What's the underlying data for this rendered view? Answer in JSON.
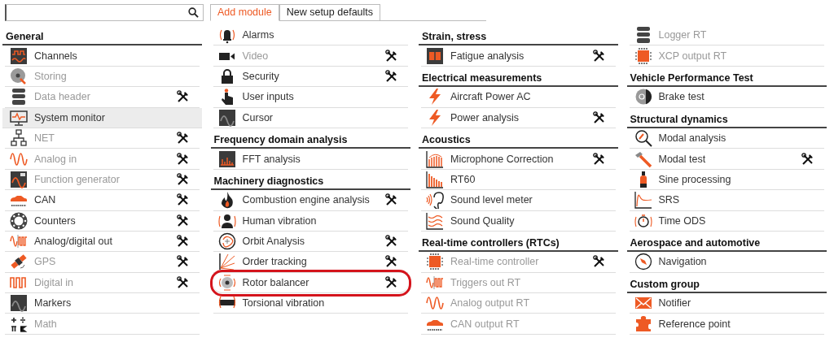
{
  "tabs": [
    {
      "label": "Add module",
      "selected": true
    },
    {
      "label": "New setup defaults",
      "selected": false
    }
  ],
  "columns": [
    {
      "entries": [
        {
          "kind": "heading",
          "label": "General"
        },
        {
          "kind": "item",
          "label": "Channels",
          "disabled": false,
          "settings": false,
          "selected": false,
          "circled": false
        },
        {
          "kind": "item",
          "label": "Storing",
          "disabled": true,
          "settings": false,
          "selected": false,
          "circled": false
        },
        {
          "kind": "item",
          "label": "Data header",
          "disabled": true,
          "settings": true,
          "selected": false,
          "circled": false
        },
        {
          "kind": "item",
          "label": "System monitor",
          "disabled": false,
          "settings": false,
          "selected": true,
          "circled": false
        },
        {
          "kind": "item",
          "label": "NET",
          "disabled": true,
          "settings": true,
          "selected": false,
          "circled": false
        },
        {
          "kind": "item",
          "label": "Analog in",
          "disabled": true,
          "settings": true,
          "selected": false,
          "circled": false
        },
        {
          "kind": "item",
          "label": "Function generator",
          "disabled": true,
          "settings": true,
          "selected": false,
          "circled": false
        },
        {
          "kind": "item",
          "label": "CAN",
          "disabled": false,
          "settings": true,
          "selected": false,
          "circled": false
        },
        {
          "kind": "item",
          "label": "Counters",
          "disabled": false,
          "settings": true,
          "selected": false,
          "circled": false
        },
        {
          "kind": "item",
          "label": "Analog/digital out",
          "disabled": false,
          "settings": true,
          "selected": false,
          "circled": false
        },
        {
          "kind": "item",
          "label": "GPS",
          "disabled": true,
          "settings": true,
          "selected": false,
          "circled": false
        },
        {
          "kind": "item",
          "label": "Digital in",
          "disabled": true,
          "settings": true,
          "selected": false,
          "circled": false
        },
        {
          "kind": "item",
          "label": "Markers",
          "disabled": false,
          "settings": false,
          "selected": false,
          "circled": false
        },
        {
          "kind": "item",
          "label": "Math",
          "disabled": true,
          "settings": false,
          "selected": false,
          "circled": false
        }
      ]
    },
    {
      "entries": [
        {
          "kind": "item",
          "label": "Alarms",
          "disabled": false,
          "settings": false,
          "selected": false,
          "circled": false
        },
        {
          "kind": "item",
          "label": "Video",
          "disabled": true,
          "settings": true,
          "selected": false,
          "circled": false
        },
        {
          "kind": "item",
          "label": "Security",
          "disabled": false,
          "settings": true,
          "selected": false,
          "circled": false
        },
        {
          "kind": "item",
          "label": "User inputs",
          "disabled": false,
          "settings": false,
          "selected": false,
          "circled": false
        },
        {
          "kind": "item",
          "label": "Cursor",
          "disabled": false,
          "settings": false,
          "selected": false,
          "circled": false
        },
        {
          "kind": "heading",
          "label": "Frequency domain analysis"
        },
        {
          "kind": "item",
          "label": "FFT analysis",
          "disabled": false,
          "settings": false,
          "selected": false,
          "circled": false
        },
        {
          "kind": "heading",
          "label": "Machinery diagnostics"
        },
        {
          "kind": "item",
          "label": "Combustion engine analysis",
          "disabled": false,
          "settings": true,
          "selected": false,
          "circled": false
        },
        {
          "kind": "item",
          "label": "Human vibration",
          "disabled": false,
          "settings": false,
          "selected": false,
          "circled": false
        },
        {
          "kind": "item",
          "label": "Orbit Analysis",
          "disabled": false,
          "settings": true,
          "selected": false,
          "circled": false
        },
        {
          "kind": "item",
          "label": "Order tracking",
          "disabled": false,
          "settings": true,
          "selected": false,
          "circled": false
        },
        {
          "kind": "item",
          "label": "Rotor balancer",
          "disabled": false,
          "settings": true,
          "selected": false,
          "circled": true
        },
        {
          "kind": "item",
          "label": "Torsional vibration",
          "disabled": false,
          "settings": false,
          "selected": false,
          "circled": false
        }
      ]
    },
    {
      "entries": [
        {
          "kind": "heading",
          "label": "Strain, stress"
        },
        {
          "kind": "item",
          "label": "Fatigue analysis",
          "disabled": false,
          "settings": true,
          "selected": false,
          "circled": false
        },
        {
          "kind": "heading",
          "label": "Electrical measurements"
        },
        {
          "kind": "item",
          "label": "Aircraft Power AC",
          "disabled": false,
          "settings": false,
          "selected": false,
          "circled": false
        },
        {
          "kind": "item",
          "label": "Power analysis",
          "disabled": false,
          "settings": true,
          "selected": false,
          "circled": false
        },
        {
          "kind": "heading",
          "label": "Acoustics"
        },
        {
          "kind": "item",
          "label": "Microphone Correction",
          "disabled": false,
          "settings": true,
          "selected": false,
          "circled": false
        },
        {
          "kind": "item",
          "label": "RT60",
          "disabled": false,
          "settings": false,
          "selected": false,
          "circled": false
        },
        {
          "kind": "item",
          "label": "Sound level meter",
          "disabled": false,
          "settings": false,
          "selected": false,
          "circled": false
        },
        {
          "kind": "item",
          "label": "Sound Quality",
          "disabled": false,
          "settings": false,
          "selected": false,
          "circled": false
        },
        {
          "kind": "heading",
          "label": "Real-time controllers (RTCs)"
        },
        {
          "kind": "item",
          "label": "Real-time controller",
          "disabled": true,
          "settings": true,
          "selected": false,
          "circled": false
        },
        {
          "kind": "item",
          "label": "Triggers out RT",
          "disabled": true,
          "settings": false,
          "selected": false,
          "circled": false
        },
        {
          "kind": "item",
          "label": "Analog output RT",
          "disabled": true,
          "settings": false,
          "selected": false,
          "circled": false
        },
        {
          "kind": "item",
          "label": "CAN output RT",
          "disabled": true,
          "settings": false,
          "selected": false,
          "circled": false
        }
      ]
    },
    {
      "entries": [
        {
          "kind": "item",
          "label": "Logger RT",
          "disabled": true,
          "settings": false,
          "selected": false,
          "circled": false
        },
        {
          "kind": "item",
          "label": "XCP output RT",
          "disabled": true,
          "settings": false,
          "selected": false,
          "circled": false
        },
        {
          "kind": "heading",
          "label": "Vehicle Performance Test"
        },
        {
          "kind": "item",
          "label": "Brake test",
          "disabled": false,
          "settings": false,
          "selected": false,
          "circled": false
        },
        {
          "kind": "heading",
          "label": "Structural dynamics"
        },
        {
          "kind": "item",
          "label": "Modal analysis",
          "disabled": false,
          "settings": false,
          "selected": false,
          "circled": false
        },
        {
          "kind": "item",
          "label": "Modal test",
          "disabled": false,
          "settings": true,
          "selected": false,
          "circled": false
        },
        {
          "kind": "item",
          "label": "Sine processing",
          "disabled": false,
          "settings": false,
          "selected": false,
          "circled": false
        },
        {
          "kind": "item",
          "label": "SRS",
          "disabled": false,
          "settings": false,
          "selected": false,
          "circled": false
        },
        {
          "kind": "item",
          "label": "Time ODS",
          "disabled": false,
          "settings": false,
          "selected": false,
          "circled": false
        },
        {
          "kind": "heading",
          "label": "Aerospace and automotive"
        },
        {
          "kind": "item",
          "label": "Navigation",
          "disabled": false,
          "settings": false,
          "selected": false,
          "circled": false
        },
        {
          "kind": "heading",
          "label": "Custom group"
        },
        {
          "kind": "item",
          "label": "Notifier",
          "disabled": false,
          "settings": false,
          "selected": false,
          "circled": false
        },
        {
          "kind": "item",
          "label": "Reference point",
          "disabled": false,
          "settings": false,
          "selected": false,
          "circled": false
        }
      ]
    }
  ]
}
